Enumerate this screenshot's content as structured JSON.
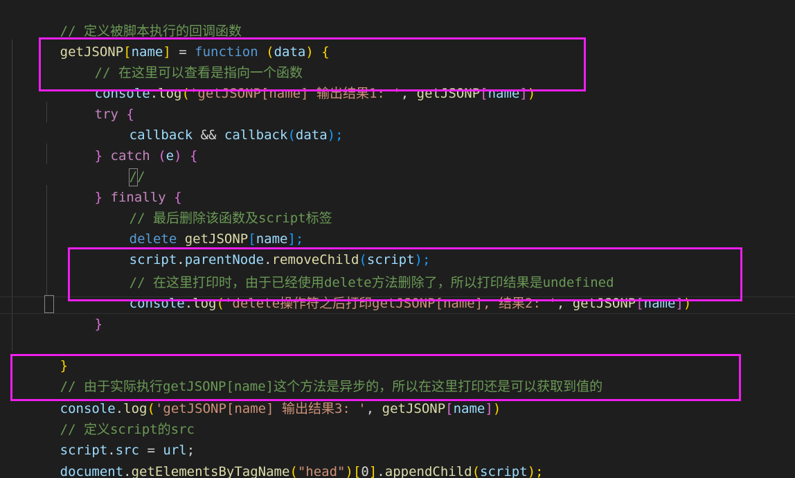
{
  "editor": {
    "background_color": "#1e1e1e",
    "font_size_px": 19,
    "line_height_px": 30,
    "annotation_color": "#EE1EEE",
    "colors": {
      "comment": "#6A9955",
      "control_keyword": "#C586C0",
      "declaration_keyword": "#569CD6",
      "function": "#DCDCAA",
      "variable": "#9CDCFE",
      "string": "#CE9178",
      "plain": "#D4D4D4",
      "bracket_level_1": "#FFD700",
      "bracket_level_2": "#DA70D6",
      "bracket_level_3": "#179FFF"
    }
  },
  "code": {
    "line01": {
      "t1": "// 定义被脚本执行的回调函数"
    },
    "line02": {
      "t1": "getJSONP",
      "t2": "[",
      "t3": "name",
      "t4": "]",
      "t5": " = ",
      "t6": "function",
      "t7": " (",
      "t8": "data",
      "t9": ") ",
      "t10": "{"
    },
    "line03": {
      "t1": "// 在这里可以查看是指向一个函数"
    },
    "line04": {
      "t1": "console",
      "t2": ".",
      "t3": "log",
      "t4": "(",
      "t5": "'getJSONP[name] 输出结果1: '",
      "t6": ", ",
      "t7": "getJSONP",
      "t8": "[",
      "t9": "name",
      "t10": "]",
      "t11": ")"
    },
    "line05": {
      "t1": "try",
      "t2": " ",
      "t3": "{"
    },
    "line06": {
      "t1": "callback",
      "t2": " && ",
      "t3": "callback",
      "t4": "(",
      "t5": "data",
      "t6": ");"
    },
    "line07": {
      "t1": "}",
      "t2": " ",
      "t3": "catch",
      "t4": " ",
      "t5": "(",
      "t6": "e",
      "t7": ")",
      "t8": " ",
      "t9": "{"
    },
    "line08": {
      "t1": "//"
    },
    "line09": {
      "t1": "}",
      "t2": " ",
      "t3": "finally",
      "t4": " ",
      "t5": "{"
    },
    "line10": {
      "t1": "// 最后删除该函数及script标签"
    },
    "line11": {
      "t1": "delete",
      "t2": " ",
      "t3": "getJSONP",
      "t4": "[",
      "t5": "name",
      "t6": "];"
    },
    "line12": {
      "t1": "script",
      "t2": ".",
      "t3": "parentNode",
      "t4": ".",
      "t5": "removeChild",
      "t6": "(",
      "t7": "script",
      "t8": ");"
    },
    "line13": {
      "t1": "// 在这里打印时，由于已经使用delete方法删除了，所以打印结果是undefined"
    },
    "line14": {
      "t1": "console",
      "t2": ".",
      "t3": "log",
      "t4": "(",
      "t5": "'delete操作符之后打印getJSONP[name], 结果2: '",
      "t6": ", ",
      "t7": "getJSONP",
      "t8": "[",
      "t9": "name",
      "t10": "]",
      "t11": ")"
    },
    "line15": {
      "t1": "}"
    },
    "line16": {
      "t1": "}"
    },
    "line17": {
      "t1": "// 由于实际执行getJSONP[name]这个方法是异步的，所以在这里打印还是可以获取到值的"
    },
    "line18": {
      "t1": "console",
      "t2": ".",
      "t3": "log",
      "t4": "(",
      "t5": "'getJSONP[name] 输出结果3: '",
      "t6": ", ",
      "t7": "getJSONP",
      "t8": "[",
      "t9": "name",
      "t10": "]",
      "t11": ")"
    },
    "line19": {
      "t1": "// 定义script的src"
    },
    "line20": {
      "t1": "script",
      "t2": ".",
      "t3": "src",
      "t4": " = ",
      "t5": "url",
      "t6": ";"
    },
    "line21": {
      "t1": "document",
      "t2": ".",
      "t3": "getElementsByTagName",
      "t4": "(",
      "t5": "\"head\"",
      "t6": ")",
      "t7": "[",
      "t8": "0",
      "t9": "]",
      "t10": ".",
      "t11": "appendChild",
      "t12": "(",
      "t13": "script",
      "t14": ");"
    }
  }
}
